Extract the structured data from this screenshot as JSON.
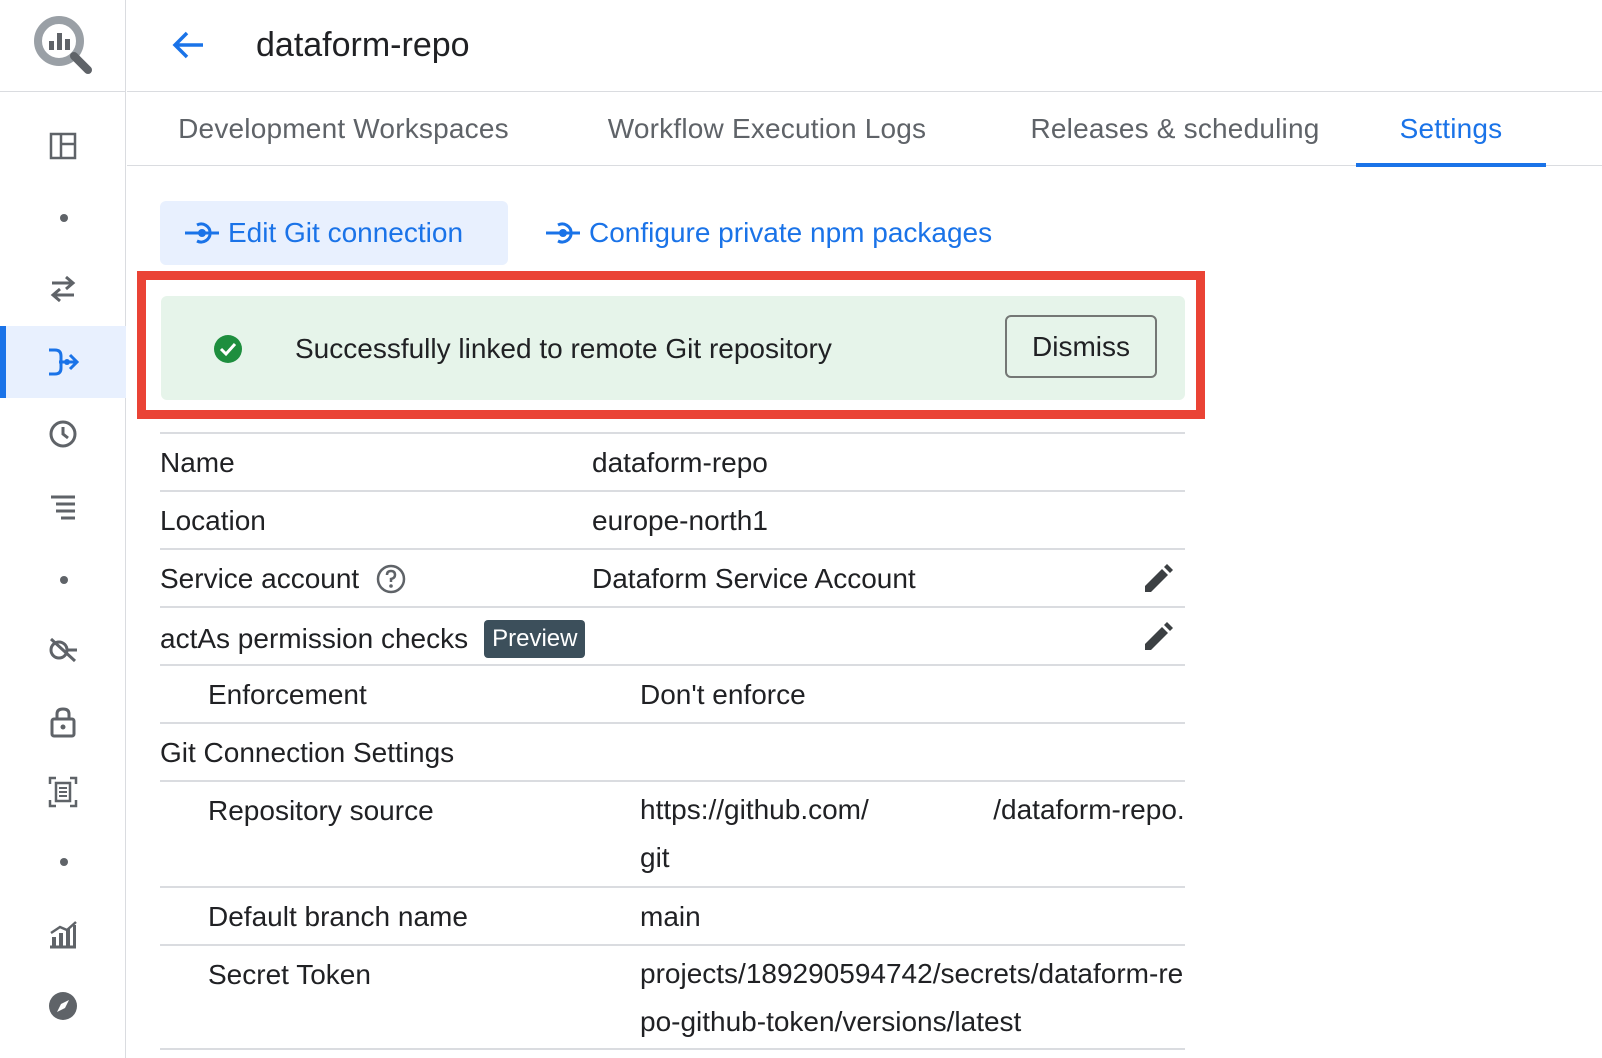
{
  "header": {
    "title": "dataform-repo"
  },
  "tabs": [
    {
      "label": "Development Workspaces",
      "active": false
    },
    {
      "label": "Workflow Execution Logs",
      "active": false
    },
    {
      "label": "Releases & scheduling",
      "active": false
    },
    {
      "label": "Settings",
      "active": true
    }
  ],
  "actions": {
    "edit_git": "Edit Git connection",
    "configure_npm": "Configure private npm packages"
  },
  "banner": {
    "message": "Successfully linked to remote Git repository",
    "dismiss_label": "Dismiss",
    "status": "success"
  },
  "details": {
    "name_label": "Name",
    "name_value": "dataform-repo",
    "location_label": "Location",
    "location_value": "europe-north1",
    "service_account_label": "Service account",
    "service_account_value": "Dataform Service Account",
    "actas_label": "actAs permission checks",
    "actas_badge": "Preview",
    "enforcement_label": "Enforcement",
    "enforcement_value": "Don't enforce",
    "git_section_label": "Git Connection Settings",
    "repo_source_label": "Repository source",
    "repo_source_value": "https://github.com/                /dataform-repo.git",
    "default_branch_label": "Default branch name",
    "default_branch_value": "main",
    "secret_token_label": "Secret Token",
    "secret_token_value": "projects/189290594742/secrets/dataform-repo-github-token/versions/latest"
  },
  "rail": {
    "items": [
      "overview-icon",
      "transfers-icon",
      "dataform-icon",
      "scheduled-queries-icon",
      "workflows-icon",
      "analytics-hub-icon",
      "policy-tags-icon",
      "capacity-icon",
      "monitoring-icon",
      "explore-icon"
    ]
  },
  "colors": {
    "accent": "#1a73e8",
    "success_bg": "#e6f4ea",
    "success_icon": "#1e8e3e",
    "highlight": "#ea4335",
    "badge_bg": "#3c4f5b"
  }
}
